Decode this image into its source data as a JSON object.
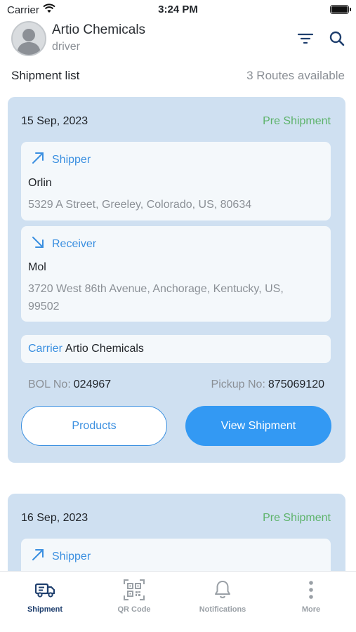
{
  "status_bar": {
    "carrier": "Carrier",
    "time": "3:24 PM"
  },
  "header": {
    "user_name": "Artio Chemicals",
    "user_role": "driver",
    "icons": [
      "filter-icon",
      "search-icon"
    ]
  },
  "list": {
    "title": "Shipment list",
    "routes_available": "3 Routes available"
  },
  "shipments": [
    {
      "date": "15 Sep, 2023",
      "status": "Pre Shipment",
      "shipper": {
        "label": "Shipper",
        "name": "Orlin",
        "address": "5329 A Street, Greeley, Colorado, US, 80634"
      },
      "receiver": {
        "label": "Receiver",
        "name": "Mol",
        "address": "3720 West 86th Avenue, Anchorage, Kentucky, US, 99502"
      },
      "carrier": {
        "label": "Carrier",
        "name": "Artio Chemicals"
      },
      "bol_label": "BOL No:",
      "bol_no": "024967",
      "pickup_label": "Pickup No:",
      "pickup_no": "875069120",
      "products_button": "Products",
      "view_button": "View Shipment"
    },
    {
      "date": "16 Sep, 2023",
      "status": "Pre Shipment",
      "shipper": {
        "label": "Shipper"
      }
    }
  ],
  "tabs": [
    {
      "label": "Shipment",
      "icon": "truck-icon",
      "active": true
    },
    {
      "label": "QR Code",
      "icon": "qr-code-icon",
      "active": false
    },
    {
      "label": "Notifications",
      "icon": "bell-icon",
      "active": false
    },
    {
      "label": "More",
      "icon": "more-vertical-icon",
      "active": false
    }
  ],
  "colors": {
    "accent": "#3399f3",
    "status_green": "#5db36a",
    "card_bg": "#cfe0f1",
    "active_tab": "#1f3f6e"
  }
}
